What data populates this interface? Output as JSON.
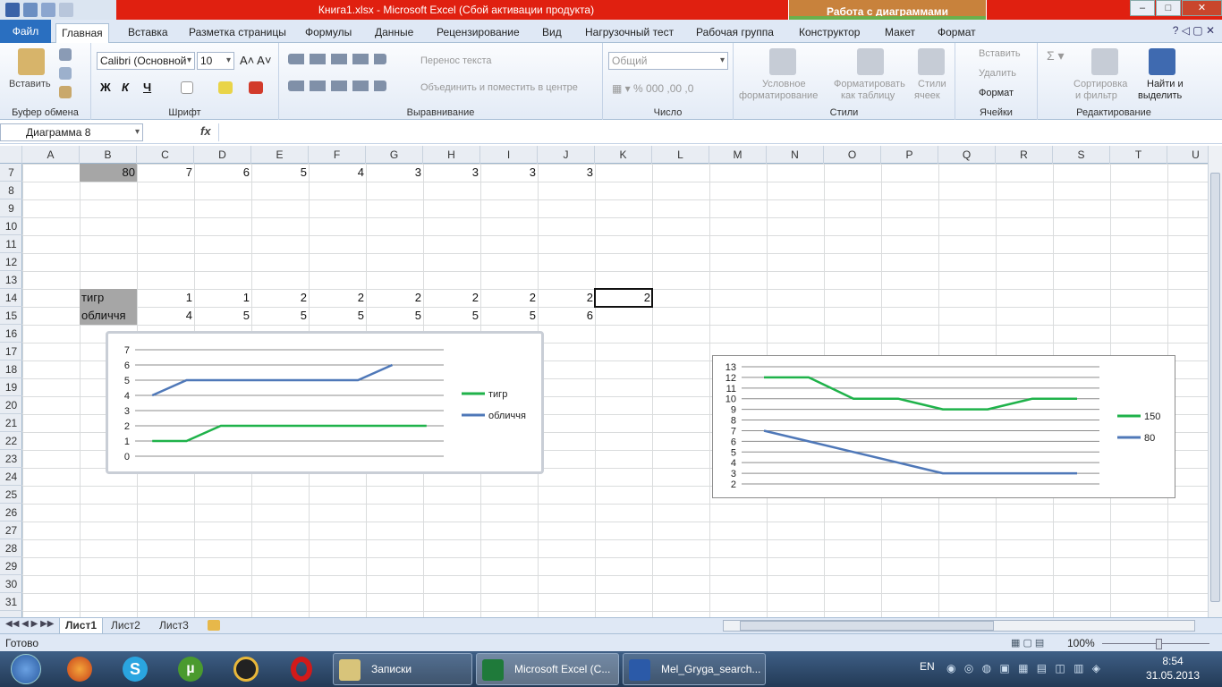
{
  "window": {
    "title": "Книга1.xlsx  -  Microsoft Excel (Сбой активации продукта)",
    "context_header": "Работа с диаграммами",
    "buttons": [
      "–",
      "□",
      "✕"
    ]
  },
  "tabs": [
    {
      "label": "Файл"
    },
    {
      "label": "Главная"
    },
    {
      "label": "Вставка"
    },
    {
      "label": "Разметка страницы"
    },
    {
      "label": "Формулы"
    },
    {
      "label": "Данные"
    },
    {
      "label": "Рецензирование"
    },
    {
      "label": "Вид"
    },
    {
      "label": "Нагрузочный тест"
    },
    {
      "label": "Рабочая группа"
    },
    {
      "label": "Конструктор"
    },
    {
      "label": "Макет"
    },
    {
      "label": "Формат"
    }
  ],
  "ribbon": {
    "clipboard": {
      "paste": "Вставить",
      "label": "Буфер обмена"
    },
    "font": {
      "name": "Calibri (Основной",
      "size": "10",
      "bold": "Ж",
      "italic": "К",
      "underline": "Ч",
      "label": "Шрифт"
    },
    "alignment": {
      "wrap": "Перенос текста",
      "merge": "Объединить и поместить в центре",
      "label": "Выравнивание"
    },
    "number": {
      "format": "Общий",
      "label": "Число"
    },
    "styles": {
      "conditional_1": "Условное",
      "conditional_2": "форматирование",
      "table_1": "Форматировать",
      "table_2": "как таблицу",
      "cell_1": "Стили",
      "cell_2": "ячеек",
      "label": "Стили"
    },
    "cells": {
      "insert": "Вставить",
      "delete": "Удалить",
      "format": "Формат",
      "label": "Ячейки"
    },
    "editing": {
      "sort_1": "Сортировка",
      "sort_2": "и фильтр",
      "find_1": "Найти и",
      "find_2": "выделить",
      "label": "Редактирование"
    }
  },
  "formula_bar": {
    "name_box": "Диаграмма 8",
    "fx": "fx",
    "value": ""
  },
  "columns": [
    "A",
    "B",
    "C",
    "D",
    "E",
    "F",
    "G",
    "H",
    "I",
    "J",
    "K",
    "L",
    "M",
    "N",
    "O",
    "P",
    "Q",
    "R",
    "S",
    "T",
    "U"
  ],
  "rows": [
    "7",
    "8",
    "9",
    "10",
    "11",
    "12",
    "13",
    "14",
    "15",
    "16",
    "17",
    "18",
    "19",
    "20",
    "21",
    "22",
    "23",
    "24",
    "25",
    "26",
    "27",
    "28",
    "29",
    "30",
    "31"
  ],
  "cells": {
    "r7": {
      "b": "80",
      "c": "7",
      "d": "6",
      "e": "5",
      "f": "4",
      "g": "3",
      "h": "3",
      "i": "3",
      "j": "3"
    },
    "r14": {
      "b": "тигр",
      "c": "1",
      "d": "1",
      "e": "2",
      "f": "2",
      "g": "2",
      "h": "2",
      "i": "2",
      "j": "2",
      "k": "2"
    },
    "r15": {
      "b": "обличчя",
      "c": "4",
      "d": "5",
      "e": "5",
      "f": "5",
      "g": "5",
      "h": "5",
      "i": "5",
      "j": "6"
    }
  },
  "chart_data": [
    {
      "type": "line",
      "ylim": [
        0,
        7
      ],
      "yticks": [
        "0",
        "1",
        "2",
        "3",
        "4",
        "5",
        "6",
        "7"
      ],
      "grid": true,
      "legend": "right",
      "series": [
        {
          "name": "тигр",
          "color": "#1fb24a",
          "values": [
            1,
            1,
            2,
            2,
            2,
            2,
            2,
            2,
            2
          ]
        },
        {
          "name": "обличчя",
          "color": "#4f78b8",
          "values": [
            4,
            5,
            5,
            5,
            5,
            5,
            5,
            6
          ]
        }
      ]
    },
    {
      "type": "line",
      "ylim": [
        2,
        13
      ],
      "yticks": [
        "2",
        "3",
        "4",
        "5",
        "6",
        "7",
        "8",
        "9",
        "10",
        "11",
        "12",
        "13"
      ],
      "grid": true,
      "legend": "right",
      "series": [
        {
          "name": "150",
          "color": "#1fb24a",
          "values": [
            12,
            12,
            10,
            10,
            9,
            9,
            10,
            10
          ]
        },
        {
          "name": "80",
          "color": "#4f78b8",
          "values": [
            7,
            6,
            5,
            4,
            3,
            3,
            3,
            3
          ]
        }
      ]
    }
  ],
  "sheets": [
    "Лист1",
    "Лист2",
    "Лист3"
  ],
  "status": {
    "ready": "Готово",
    "zoom": "100%"
  },
  "taskbar": {
    "windows": [
      "Записки",
      "Microsoft Excel (C...",
      "Mel_Gryga_search..."
    ],
    "lang": "EN",
    "time": "8:54",
    "date": "31.05.2013"
  }
}
